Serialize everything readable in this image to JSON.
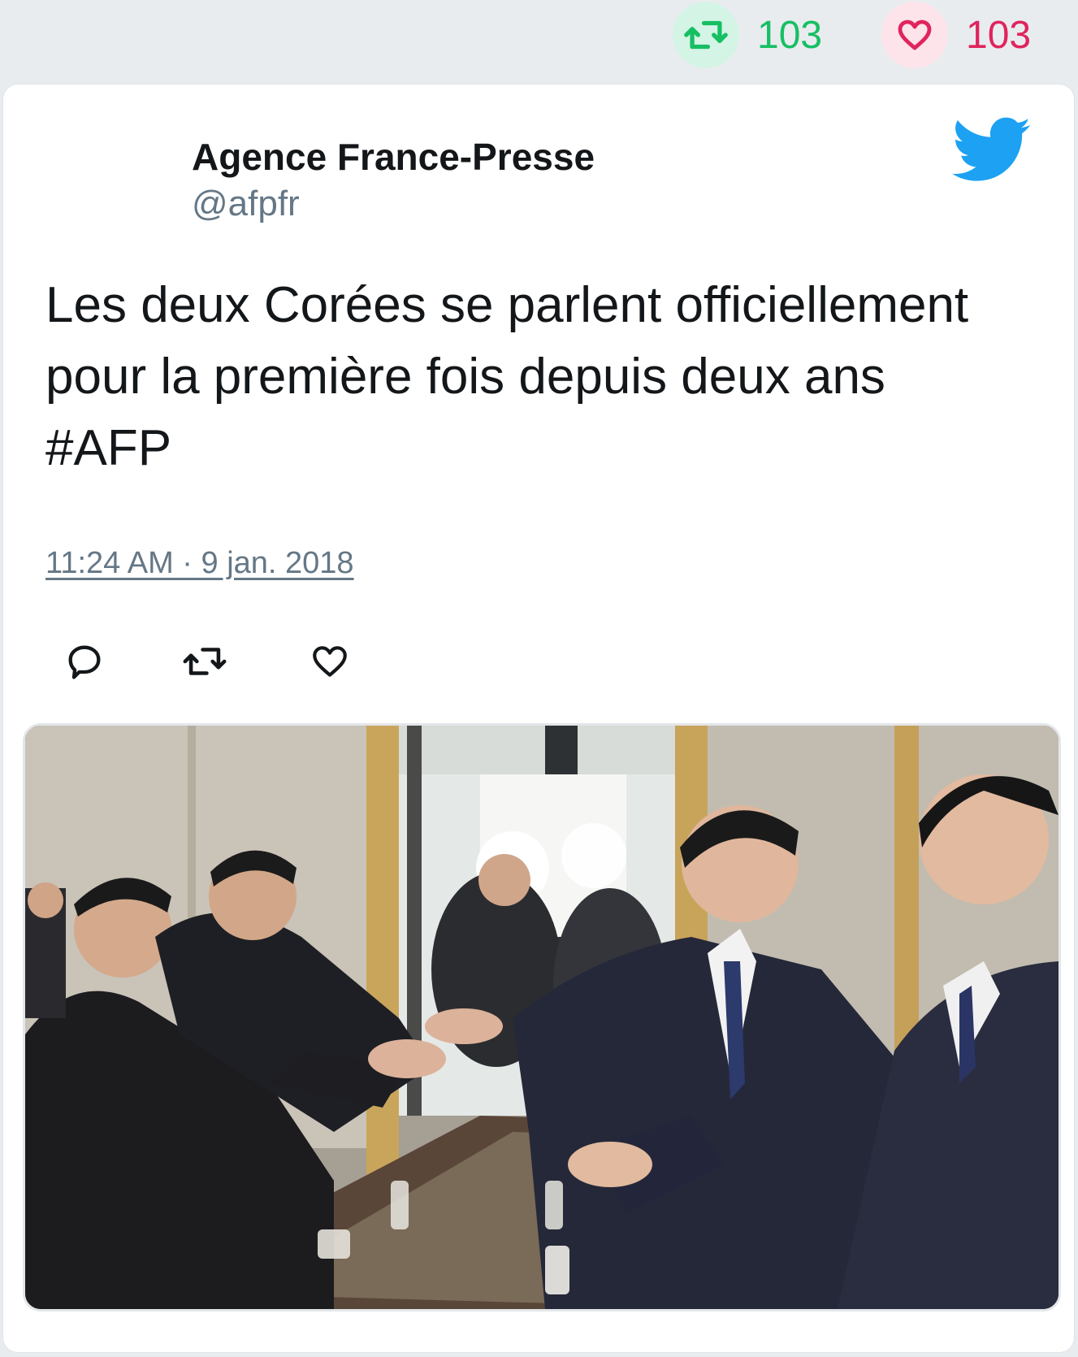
{
  "stats": {
    "retweets": "103",
    "likes": "103",
    "retweet_icon": "retweet-icon",
    "like_icon": "heart-icon"
  },
  "tweet": {
    "author_name": "Agence France-Presse",
    "author_handle": "@afpfr",
    "text": "Les deux Corées se parlent officiellement pour la première fois depuis deux ans #AFP",
    "timestamp": "11:24 AM · 9 jan. 2018",
    "brand_icon": "twitter-bird-icon"
  },
  "actions": {
    "reply_icon": "reply-icon",
    "retweet_icon": "retweet-icon",
    "like_icon": "heart-icon"
  },
  "colors": {
    "retweet": "#17bf63",
    "like": "#e0245e",
    "twitter_blue": "#1da1f2",
    "muted": "#657786"
  }
}
